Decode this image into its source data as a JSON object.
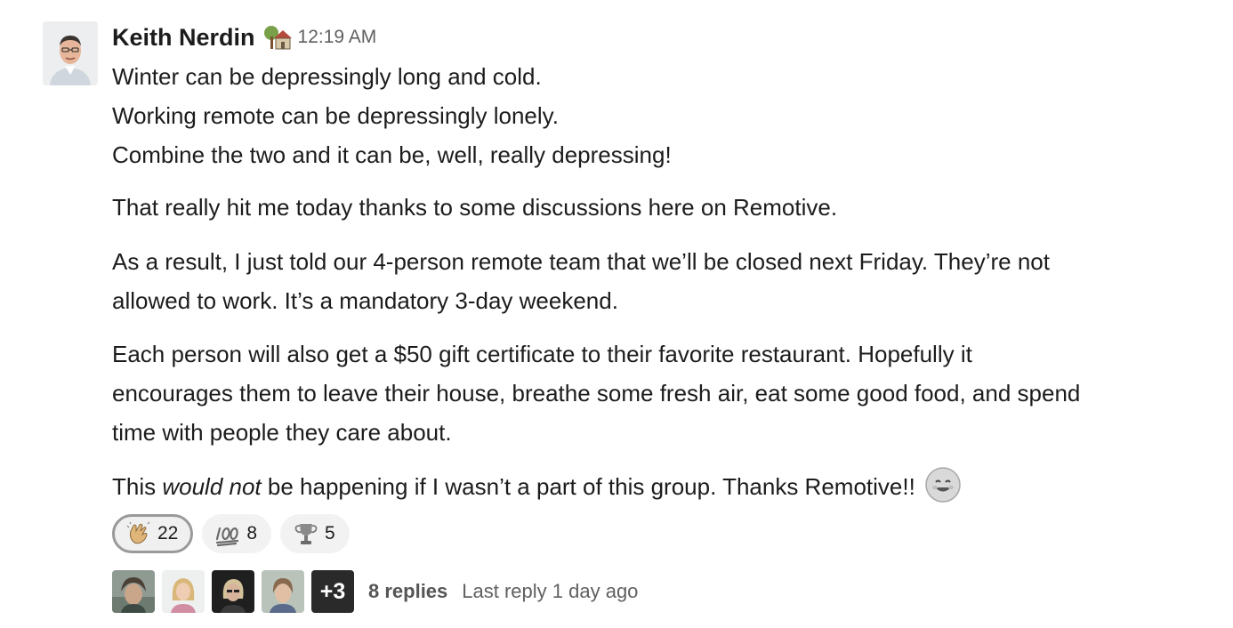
{
  "message": {
    "author": "Keith Nerdin",
    "status_icon": "house-with-tree-icon",
    "timestamp": "12:19 AM",
    "paragraphs": {
      "p1": [
        "Winter can be depressingly long and cold.",
        "Working remote can be depressingly lonely.",
        "Combine the two and it can be, well, really depressing!"
      ],
      "p2": [
        "That really hit me today thanks to some discussions here on Remotive."
      ],
      "p3": [
        "As a result, I just told our 4-person remote team that we’ll be closed next Friday. They’re not",
        "allowed to work. It’s a mandatory 3-day weekend."
      ],
      "p4": [
        "Each person will also get a $50 gift certificate to their favorite restaurant. Hopefully it",
        "encourages them to leave their house, breathe some fresh air, eat some good food, and spend",
        "time with people they care about."
      ],
      "p5": {
        "before": "This ",
        "italic": "would not",
        "after": " be happening if I wasn’t a part of this group. Thanks Remotive!!",
        "emoji": "smiling-face-icon"
      }
    }
  },
  "reactions": [
    {
      "icon": "clapping-hands-icon",
      "count": "22",
      "selected": true
    },
    {
      "icon": "hundred-points-icon",
      "count": "8",
      "selected": false
    },
    {
      "icon": "trophy-icon",
      "count": "5",
      "selected": false
    }
  ],
  "thread": {
    "more_participants": "+3",
    "reply_count": "8 replies",
    "last_reply": "Last reply 1 day ago"
  }
}
